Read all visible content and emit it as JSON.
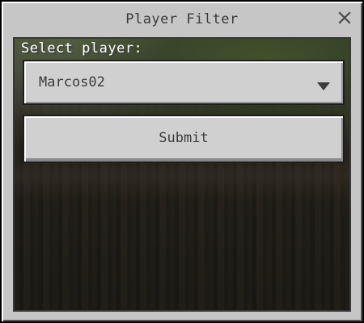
{
  "window": {
    "title": "Player Filter",
    "close_icon": "close-icon"
  },
  "form": {
    "label": "Select player:",
    "dropdown": {
      "selected": "Marcos02",
      "icon": "triangle-down-icon"
    },
    "submit_label": "Submit"
  },
  "colors": {
    "panel": "#c6c6c6",
    "button_face": "#d0d0d0",
    "text_dark": "#3c3c3c",
    "label_text": "#ffffff",
    "border": "#1e1e1e"
  }
}
